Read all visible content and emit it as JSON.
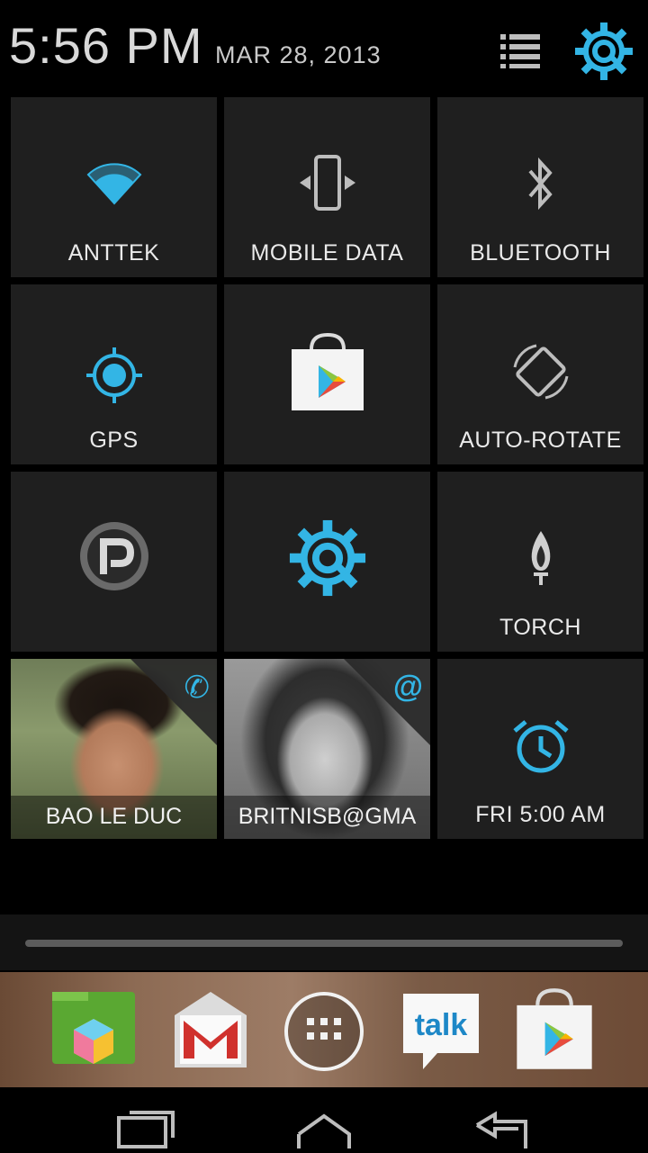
{
  "status": {
    "time": "5:56 PM",
    "date": "MAR 28, 2013"
  },
  "header_icons": {
    "list": "list-icon",
    "settings": "quick-settings-gear-icon",
    "accent": "#33b5e5"
  },
  "tiles": {
    "wifi": {
      "label": "ANTTEK",
      "icon": "wifi-icon"
    },
    "mobile_data": {
      "label": "MOBILE DATA",
      "icon": "mobile-data-icon"
    },
    "bluetooth": {
      "label": "BLUETOOTH",
      "icon": "bluetooth-icon"
    },
    "gps": {
      "label": "GPS",
      "icon": "gps-icon"
    },
    "play_store": {
      "label": "",
      "icon": "play-store-icon"
    },
    "auto_rotate": {
      "label": "AUTO-ROTATE",
      "icon": "auto-rotate-icon"
    },
    "app_p": {
      "label": "",
      "icon": "p-logo-icon"
    },
    "quick_settings": {
      "label": "",
      "icon": "quick-settings-gear-icon"
    },
    "torch": {
      "label": "TORCH",
      "icon": "torch-icon"
    },
    "contact1": {
      "label": "BAO LE DUC",
      "icon": "phone-icon",
      "badge": "✆"
    },
    "contact2": {
      "label": "BRITNISB@GMA",
      "icon": "at-icon",
      "badge": "@"
    },
    "alarm": {
      "label": "FRI 5:00 AM",
      "icon": "alarm-icon"
    }
  },
  "dock": {
    "items": [
      {
        "name": "files-app",
        "icon": "files-icon"
      },
      {
        "name": "gmail-app",
        "icon": "gmail-icon"
      },
      {
        "name": "app-drawer",
        "icon": "app-drawer-icon"
      },
      {
        "name": "talk-app",
        "icon": "talk-icon",
        "label": "talk"
      },
      {
        "name": "play-store-app",
        "icon": "play-store-icon"
      }
    ]
  },
  "navbar": {
    "recents": "recents-icon",
    "home": "home-icon",
    "back": "back-icon"
  }
}
